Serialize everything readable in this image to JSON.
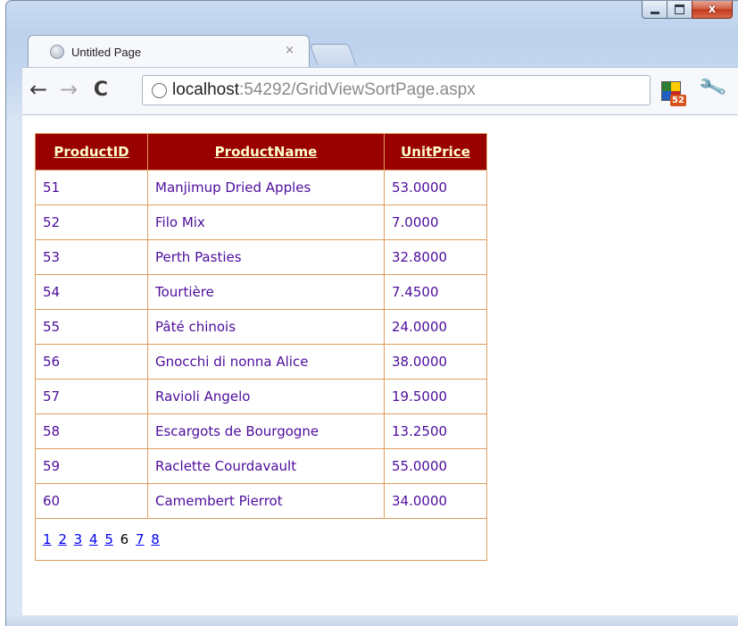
{
  "window": {
    "minimize_icon": "minimize-icon",
    "maximize_icon": "maximize-icon",
    "close_glyph": "x"
  },
  "tab": {
    "title": "Untitled Page",
    "close_glyph": "×"
  },
  "toolbar": {
    "back_glyph": "←",
    "forward_glyph": "→",
    "reload_glyph": "C",
    "url_host": "localhost",
    "url_rest": ":54292/GridViewSortPage.aspx",
    "extension_badge": "52",
    "wrench_glyph": "🔧"
  },
  "grid": {
    "headers": [
      "ProductID",
      "ProductName",
      "UnitPrice"
    ],
    "rows": [
      [
        "51",
        "Manjimup Dried Apples",
        "53.0000"
      ],
      [
        "52",
        "Filo Mix",
        "7.0000"
      ],
      [
        "53",
        "Perth Pasties",
        "32.8000"
      ],
      [
        "54",
        "Tourtière",
        "7.4500"
      ],
      [
        "55",
        "Pâté chinois",
        "24.0000"
      ],
      [
        "56",
        "Gnocchi di nonna Alice",
        "38.0000"
      ],
      [
        "57",
        "Ravioli Angelo",
        "19.5000"
      ],
      [
        "58",
        "Escargots de Bourgogne",
        "13.2500"
      ],
      [
        "59",
        "Raclette Courdavault",
        "55.0000"
      ],
      [
        "60",
        "Camembert Pierrot",
        "34.0000"
      ]
    ],
    "pager": {
      "pages": [
        "1",
        "2",
        "3",
        "4",
        "5",
        "6",
        "7",
        "8"
      ],
      "current": "6"
    }
  },
  "colors": {
    "header_bg": "#990000",
    "header_text": "#ffffcc",
    "cell_text": "#4d0d9c",
    "border": "#de9d5e",
    "pager_link": "#0000ee"
  }
}
